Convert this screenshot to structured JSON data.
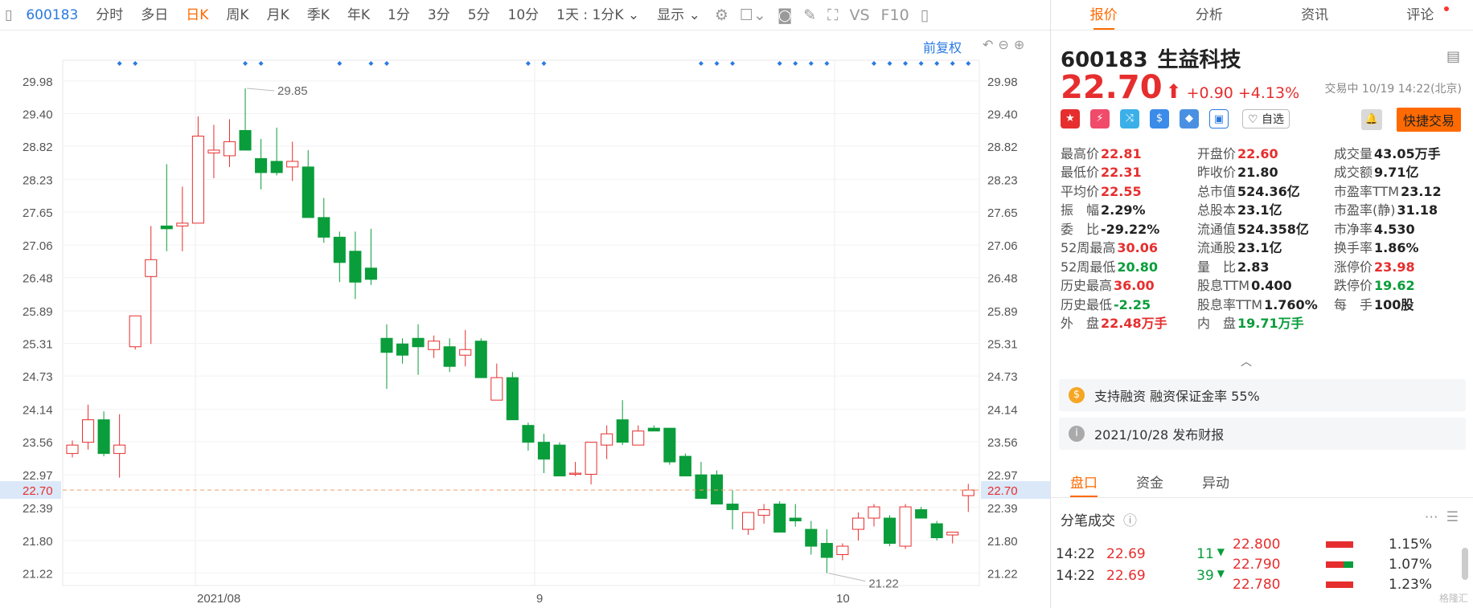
{
  "toolbar": {
    "code": "600183",
    "items": [
      "分时",
      "多日",
      "日K",
      "周K",
      "月K",
      "季K",
      "年K",
      "1分",
      "3分",
      "5分",
      "10分",
      "1天 : 1分K"
    ],
    "active": "日K",
    "display": "显示",
    "icons": [
      "settings-icon",
      "checkbox-icon",
      "camera-icon",
      "pen-icon",
      "fullscreen-icon",
      "vs-icon",
      "f10-icon",
      "panel-toggle-icon"
    ],
    "vs": "VS",
    "f10": "F10"
  },
  "chart_controls": {
    "fuquan": "前复权"
  },
  "chart_data": {
    "type": "candlestick",
    "x": [
      "2021-07-26",
      "2021-07-27",
      "2021-07-28",
      "2021-07-29",
      "2021-07-30",
      "2021-08-02",
      "2021-08-03",
      "2021-08-04",
      "2021-08-05",
      "2021-08-06",
      "2021-08-09",
      "2021-08-10",
      "2021-08-11",
      "2021-08-12",
      "2021-08-13",
      "2021-08-16",
      "2021-08-17",
      "2021-08-18",
      "2021-08-19",
      "2021-08-20",
      "2021-08-23",
      "2021-08-24",
      "2021-08-25",
      "2021-08-26",
      "2021-08-27",
      "2021-08-30",
      "2021-08-31",
      "2021-09-01",
      "2021-09-02",
      "2021-09-03",
      "2021-09-06",
      "2021-09-07",
      "2021-09-08",
      "2021-09-09",
      "2021-09-10",
      "2021-09-13",
      "2021-09-14",
      "2021-09-15",
      "2021-09-16",
      "2021-09-17",
      "2021-09-22",
      "2021-09-23",
      "2021-09-24",
      "2021-09-27",
      "2021-09-28",
      "2021-09-29",
      "2021-09-30",
      "2021-10-08",
      "2021-10-11",
      "2021-10-12",
      "2021-10-13",
      "2021-10-14",
      "2021-10-15",
      "2021-10-18",
      "2021-10-19"
    ],
    "ohlc": [
      [
        23.35,
        23.58,
        23.28,
        23.5
      ],
      [
        23.55,
        24.22,
        23.42,
        23.95
      ],
      [
        23.95,
        24.1,
        23.3,
        23.35
      ],
      [
        23.35,
        24.05,
        22.92,
        23.5
      ],
      [
        25.25,
        25.8,
        25.2,
        25.8
      ],
      [
        26.5,
        27.4,
        25.3,
        26.8
      ],
      [
        27.4,
        28.5,
        26.95,
        27.35
      ],
      [
        27.4,
        28.1,
        26.95,
        27.45
      ],
      [
        27.45,
        29.35,
        27.45,
        29.0
      ],
      [
        28.7,
        29.2,
        28.25,
        28.75
      ],
      [
        28.65,
        29.3,
        28.45,
        28.9
      ],
      [
        29.1,
        29.85,
        28.82,
        28.75
      ],
      [
        28.6,
        28.95,
        28.05,
        28.35
      ],
      [
        28.55,
        29.15,
        28.3,
        28.35
      ],
      [
        28.45,
        28.9,
        28.2,
        28.55
      ],
      [
        28.45,
        28.75,
        27.55,
        27.55
      ],
      [
        27.55,
        27.9,
        27.1,
        27.2
      ],
      [
        27.2,
        27.3,
        26.4,
        26.75
      ],
      [
        26.95,
        27.3,
        26.1,
        26.4
      ],
      [
        26.65,
        27.35,
        26.35,
        26.45
      ],
      [
        25.4,
        25.65,
        24.5,
        25.15
      ],
      [
        25.3,
        25.4,
        24.95,
        25.1
      ],
      [
        25.4,
        25.65,
        24.75,
        25.25
      ],
      [
        25.2,
        25.45,
        25.05,
        25.35
      ],
      [
        25.25,
        25.4,
        24.8,
        24.9
      ],
      [
        25.1,
        25.55,
        24.9,
        25.2
      ],
      [
        25.35,
        25.4,
        24.7,
        24.7
      ],
      [
        24.3,
        24.95,
        24.3,
        24.7
      ],
      [
        24.7,
        24.8,
        23.95,
        23.95
      ],
      [
        23.85,
        23.9,
        23.4,
        23.55
      ],
      [
        23.55,
        23.7,
        23.0,
        23.25
      ],
      [
        23.5,
        23.55,
        22.95,
        22.95
      ],
      [
        22.98,
        23.2,
        22.95,
        23.0
      ],
      [
        22.98,
        23.55,
        22.8,
        23.55
      ],
      [
        23.5,
        23.85,
        23.25,
        23.7
      ],
      [
        23.95,
        24.3,
        23.5,
        23.55
      ],
      [
        23.5,
        23.85,
        23.5,
        23.75
      ],
      [
        23.8,
        23.85,
        23.75,
        23.75
      ],
      [
        23.8,
        23.8,
        23.15,
        23.2
      ],
      [
        23.3,
        23.35,
        22.95,
        22.95
      ],
      [
        22.97,
        23.2,
        22.55,
        22.55
      ],
      [
        22.97,
        23.05,
        22.5,
        22.45
      ],
      [
        22.45,
        22.7,
        22.0,
        22.35
      ],
      [
        22.0,
        22.3,
        21.9,
        22.3
      ],
      [
        22.25,
        22.45,
        22.1,
        22.35
      ],
      [
        22.45,
        22.5,
        21.95,
        21.95
      ],
      [
        22.2,
        22.45,
        22.05,
        22.15
      ],
      [
        22.0,
        22.15,
        21.55,
        21.7
      ],
      [
        21.75,
        22.0,
        21.22,
        21.5
      ],
      [
        21.55,
        21.75,
        21.45,
        21.7
      ],
      [
        22.0,
        22.3,
        21.8,
        22.2
      ],
      [
        22.2,
        22.45,
        22.05,
        22.4
      ],
      [
        22.2,
        22.25,
        21.7,
        21.75
      ],
      [
        21.7,
        22.45,
        21.65,
        22.4
      ],
      [
        22.35,
        22.4,
        22.2,
        22.2
      ],
      [
        22.1,
        22.15,
        21.8,
        21.85
      ],
      [
        21.9,
        21.95,
        21.75,
        21.95
      ],
      [
        22.6,
        22.81,
        22.31,
        22.7
      ]
    ],
    "x_ticks": [
      "2021/08",
      "9",
      "10"
    ],
    "y_ticks": [
      29.98,
      29.4,
      28.82,
      28.23,
      27.65,
      27.06,
      26.48,
      25.89,
      25.31,
      24.73,
      24.14,
      23.56,
      22.97,
      22.39,
      21.8,
      21.22
    ],
    "ylim": [
      21.0,
      30.35
    ],
    "annotations": [
      {
        "label": "29.85",
        "value": 29.85
      },
      {
        "label": "21.22",
        "value": 21.22
      }
    ],
    "current_price": 22.7,
    "current_label": "22.70",
    "up_color": "#e62e2e",
    "down_color": "#0a9d3b"
  },
  "stock": {
    "code": "600183",
    "name": "生益科技",
    "price": "22.70",
    "arrow": "⬆",
    "change": "+0.90",
    "pct": "+4.13%",
    "trade_time": "交易中 10/19 14:22(北京)",
    "zixuan": "♡ 自选",
    "quick": "快捷交易"
  },
  "stats": [
    [
      {
        "l": "最高价",
        "v": "22.81",
        "c": "red"
      },
      {
        "l": "开盘价",
        "v": "22.60",
        "c": "red"
      },
      {
        "l": "成交量",
        "v": "43.05万手",
        "c": "dk"
      }
    ],
    [
      {
        "l": "最低价",
        "v": "22.31",
        "c": "red"
      },
      {
        "l": "昨收价",
        "v": "21.80",
        "c": "dk"
      },
      {
        "l": "成交额",
        "v": "9.71亿",
        "c": "dk"
      }
    ],
    [
      {
        "l": "平均价",
        "v": "22.55",
        "c": "red"
      },
      {
        "l": "总市值",
        "v": "524.36亿",
        "c": "dk"
      },
      {
        "l": "市盈率TTM",
        "v": "23.12",
        "c": "dk"
      }
    ],
    [
      {
        "l": "振　幅",
        "v": "2.29%",
        "c": "dk"
      },
      {
        "l": "总股本",
        "v": "23.1亿",
        "c": "dk"
      },
      {
        "l": "市盈率(静)",
        "v": "31.18",
        "c": "dk"
      }
    ],
    [
      {
        "l": "委　比",
        "v": "-29.22%",
        "c": "dk"
      },
      {
        "l": "流通值",
        "v": "524.358亿",
        "c": "dk"
      },
      {
        "l": "市净率",
        "v": "4.530",
        "c": "dk"
      }
    ],
    [
      {
        "l": "52周最高",
        "v": "30.06",
        "c": "red"
      },
      {
        "l": "流通股",
        "v": "23.1亿",
        "c": "dk"
      },
      {
        "l": "换手率",
        "v": "1.86%",
        "c": "dk"
      }
    ],
    [
      {
        "l": "52周最低",
        "v": "20.80",
        "c": "green"
      },
      {
        "l": "量　比",
        "v": "2.83",
        "c": "dk"
      },
      {
        "l": "涨停价",
        "v": "23.98",
        "c": "red"
      }
    ],
    [
      {
        "l": "历史最高",
        "v": "36.00",
        "c": "red"
      },
      {
        "l": "股息TTM",
        "v": "0.400",
        "c": "dk"
      },
      {
        "l": "跌停价",
        "v": "19.62",
        "c": "green"
      }
    ],
    [
      {
        "l": "历史最低",
        "v": "-2.25",
        "c": "green"
      },
      {
        "l": "股息率TTM",
        "v": "1.760%",
        "c": "dk"
      },
      {
        "l": "每　手",
        "v": "100股",
        "c": "dk"
      }
    ],
    [
      {
        "l": "外　盘",
        "v": "22.48万手",
        "c": "red"
      },
      {
        "l": "内　盘",
        "v": "19.71万手",
        "c": "green"
      },
      {
        "l": "",
        "v": "",
        "c": "dk"
      }
    ]
  ],
  "info": {
    "margin": "支持融资 融资保证金率 55%",
    "report": "2021/10/28 发布财报"
  },
  "right_tabs": [
    "报价",
    "分析",
    "资讯",
    "评论"
  ],
  "bottom_tabs": [
    "盘口",
    "资金",
    "异动"
  ],
  "fenbi_title": "分笔成交",
  "trades": [
    {
      "t": "14:22",
      "p": "22.69",
      "v": "11"
    },
    {
      "t": "14:22",
      "p": "22.69",
      "v": "39"
    }
  ],
  "depth": [
    {
      "p": "22.800",
      "pc": "1.15%",
      "g": 0
    },
    {
      "p": "22.790",
      "pc": "1.07%",
      "g": 0.35
    },
    {
      "p": "22.780",
      "pc": "1.23%",
      "g": 0
    }
  ],
  "watermark": "格隆汇"
}
